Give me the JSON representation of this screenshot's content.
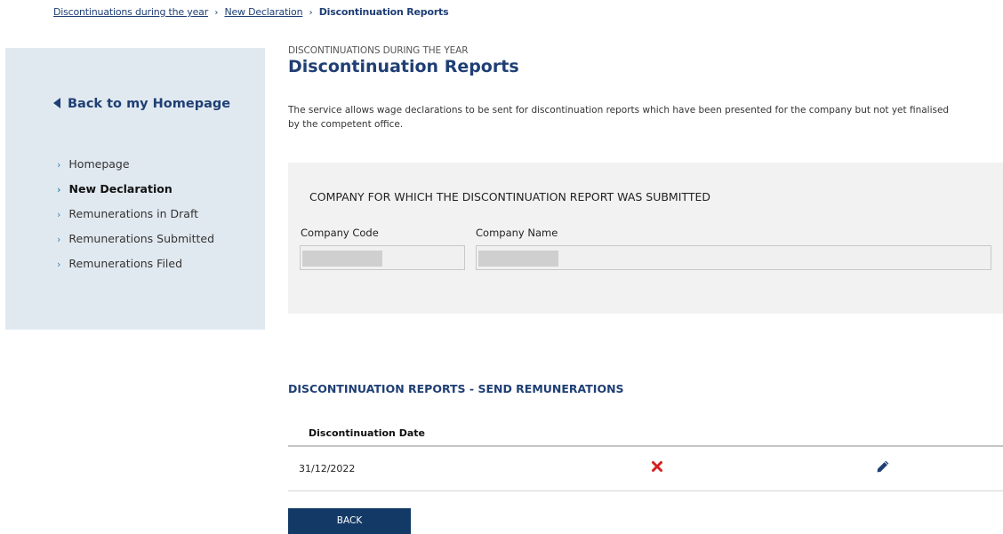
{
  "breadcrumb": {
    "items": [
      "Discontinuations during the year",
      "New Declaration"
    ],
    "current": "Discontinuation Reports",
    "separator": "›"
  },
  "sidebar": {
    "back_label": "Back to my Homepage",
    "chevron": "›",
    "items": [
      {
        "label": "Homepage"
      },
      {
        "label": "New Declaration"
      },
      {
        "label": "Remunerations in Draft"
      },
      {
        "label": "Remunerations Submitted"
      },
      {
        "label": "Remunerations Filed"
      }
    ]
  },
  "main": {
    "overline": "DISCONTINUATIONS DURING THE YEAR",
    "title": "Discontinuation Reports",
    "intro": "The service allows wage declarations to be sent for discontinuation reports which have been presented for the company but not yet finalised",
    "intro_line2": "by the competent office.",
    "company_panel": {
      "title": "COMPANY FOR WHICH THE DISCONTINUATION REPORT WAS SUBMITTED",
      "code_label": "Company Code",
      "name_label": "Company Name"
    },
    "reports": {
      "title": "DISCONTINUATION REPORTS - SEND REMUNERATIONS",
      "column_date": "Discontinuation Date",
      "rows": [
        {
          "date": "31/12/2022"
        }
      ]
    },
    "back_button": "BACK"
  },
  "colors": {
    "brand": "#1f3f74",
    "button": "#133a66",
    "delete": "#d42020",
    "sidebar_bg": "#e1e9f0"
  }
}
